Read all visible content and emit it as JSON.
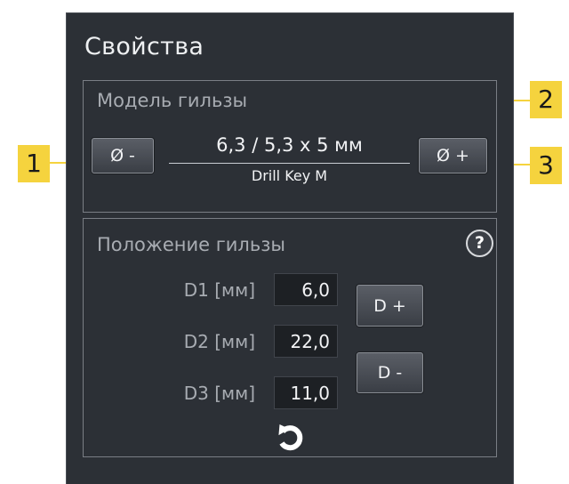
{
  "panel": {
    "title": "Свойства"
  },
  "sleeve_model": {
    "title": "Модель гильзы",
    "size_text": "6,3 / 5,3 x 5 мм",
    "key_name": "Drill Key M",
    "diameter_minus_label": "Ø -",
    "diameter_plus_label": "Ø +"
  },
  "sleeve_position": {
    "title": "Положение гильзы",
    "help_label": "?",
    "rows": [
      {
        "label": "D1 [мм]",
        "value": "6,0"
      },
      {
        "label": "D2 [мм]",
        "value": "22,0"
      },
      {
        "label": "D3 [мм]",
        "value": "11,0"
      }
    ],
    "d_plus_label": "D +",
    "d_minus_label": "D -",
    "reset_icon": "reset-rotate-icon"
  },
  "callouts": [
    "1",
    "2",
    "3"
  ],
  "colors": {
    "panel_bg": "#2c3036",
    "callout": "#f5d33e",
    "field_bg": "#1d2024"
  }
}
